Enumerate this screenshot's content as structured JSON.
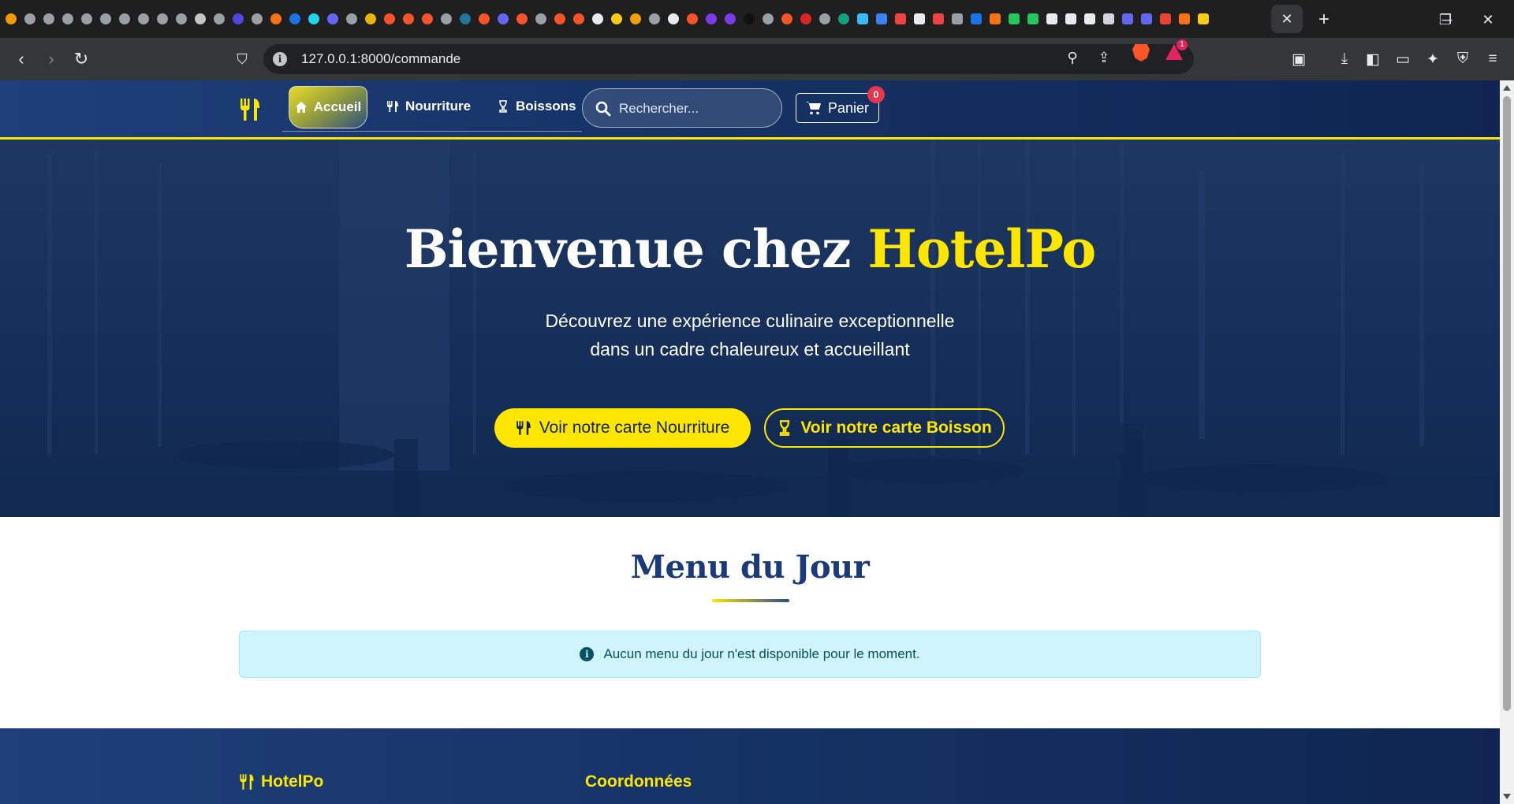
{
  "browser": {
    "url": "127.0.0.1:8000/commande",
    "active_tab_close": "✕",
    "new_tab": "+",
    "rewards_badge": "1"
  },
  "navbar": {
    "links": [
      {
        "label": "Accueil",
        "icon": "home-icon"
      },
      {
        "label": "Nourriture",
        "icon": "utensils-icon"
      },
      {
        "label": "Boissons",
        "icon": "wine-glass-icon"
      }
    ],
    "search_placeholder": "Rechercher...",
    "cart_label": "Panier",
    "cart_count": "0"
  },
  "hero": {
    "title_prefix": "Bienvenue chez",
    "title_brand": "HotelPo",
    "subtitle_line1": "Découvrez une expérience culinaire exceptionnelle",
    "subtitle_line2": "dans un cadre chaleureux et accueillant",
    "btn_food": "Voir notre carte Nourriture",
    "btn_drink": "Voir notre carte Boisson"
  },
  "menu": {
    "title": "Menu du Jour",
    "empty_message": "Aucun menu du jour n'est disponible pour le moment."
  },
  "footer": {
    "brand": "HotelPo",
    "contact_heading": "Coordonnées"
  },
  "colors": {
    "primary_navy": "#143061",
    "accent_yellow": "#ffe600",
    "alert_bg": "#cff4fc",
    "badge_red": "#e5364c"
  }
}
